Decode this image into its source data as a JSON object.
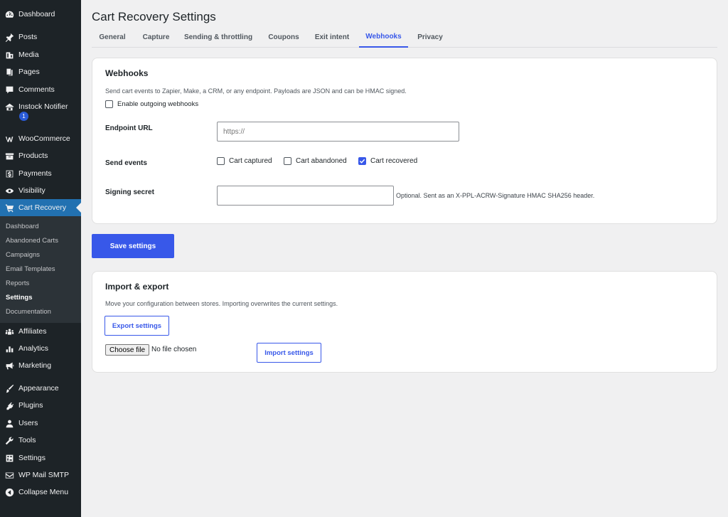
{
  "sidebar": {
    "items": [
      {
        "label": "Dashboard",
        "icon": "dashboard-icon"
      },
      {
        "label": "Posts",
        "icon": "pin-icon"
      },
      {
        "label": "Media",
        "icon": "media-icon"
      },
      {
        "label": "Pages",
        "icon": "pages-icon"
      },
      {
        "label": "Comments",
        "icon": "comment-icon"
      },
      {
        "label": "Instock Notifier",
        "icon": "store-icon",
        "badge": "1"
      },
      {
        "label": "WooCommerce",
        "icon": "woo-icon"
      },
      {
        "label": "Products",
        "icon": "archive-icon"
      },
      {
        "label": "Payments",
        "icon": "dollar-icon"
      },
      {
        "label": "Visibility",
        "icon": "eye-icon"
      },
      {
        "label": "Cart Recovery",
        "icon": "cart-icon"
      },
      {
        "label": "Affiliates",
        "icon": "groups-icon"
      },
      {
        "label": "Analytics",
        "icon": "chart-icon"
      },
      {
        "label": "Marketing",
        "icon": "megaphone-icon"
      },
      {
        "label": "Appearance",
        "icon": "brush-icon"
      },
      {
        "label": "Plugins",
        "icon": "plug-icon"
      },
      {
        "label": "Users",
        "icon": "user-icon"
      },
      {
        "label": "Tools",
        "icon": "wrench-icon"
      },
      {
        "label": "Settings",
        "icon": "settings-icon"
      },
      {
        "label": "WP Mail SMTP",
        "icon": "mail-icon"
      },
      {
        "label": "Collapse Menu",
        "icon": "collapse-icon"
      }
    ],
    "submenu": [
      "Dashboard",
      "Abandoned Carts",
      "Campaigns",
      "Email Templates",
      "Reports",
      "Settings",
      "Documentation"
    ]
  },
  "page": {
    "title": "Cart Recovery Settings",
    "tabs": [
      "General",
      "Capture",
      "Sending & throttling",
      "Coupons",
      "Exit intent",
      "Webhooks",
      "Privacy"
    ],
    "active_tab": "Webhooks"
  },
  "webhooks": {
    "title": "Webhooks",
    "description": "Send cart events to Zapier, Make, a CRM, or any endpoint. Payloads are JSON and can be HMAC signed.",
    "enable_label": "Enable outgoing webhooks",
    "enable_checked": false,
    "endpoint_label": "Endpoint URL",
    "endpoint_placeholder": "https://",
    "events_label": "Send events",
    "events": [
      {
        "label": "Cart captured",
        "checked": false
      },
      {
        "label": "Cart abandoned",
        "checked": false
      },
      {
        "label": "Cart recovered",
        "checked": true
      }
    ],
    "secret_label": "Signing secret",
    "secret_hint": "Optional. Sent as an X-PPL-ACRW-Signature HMAC SHA256 header."
  },
  "save_label": "Save settings",
  "import_export": {
    "title": "Import & export",
    "description": "Move your configuration between stores. Importing overwrites the current settings.",
    "export_label": "Export settings",
    "choose_file_label": "Choose file",
    "no_file_label": "No file chosen",
    "import_label": "Import settings"
  },
  "colors": {
    "sidebar_bg": "#1d2327",
    "active_menu": "#2271b1",
    "accent": "#3858e9"
  }
}
